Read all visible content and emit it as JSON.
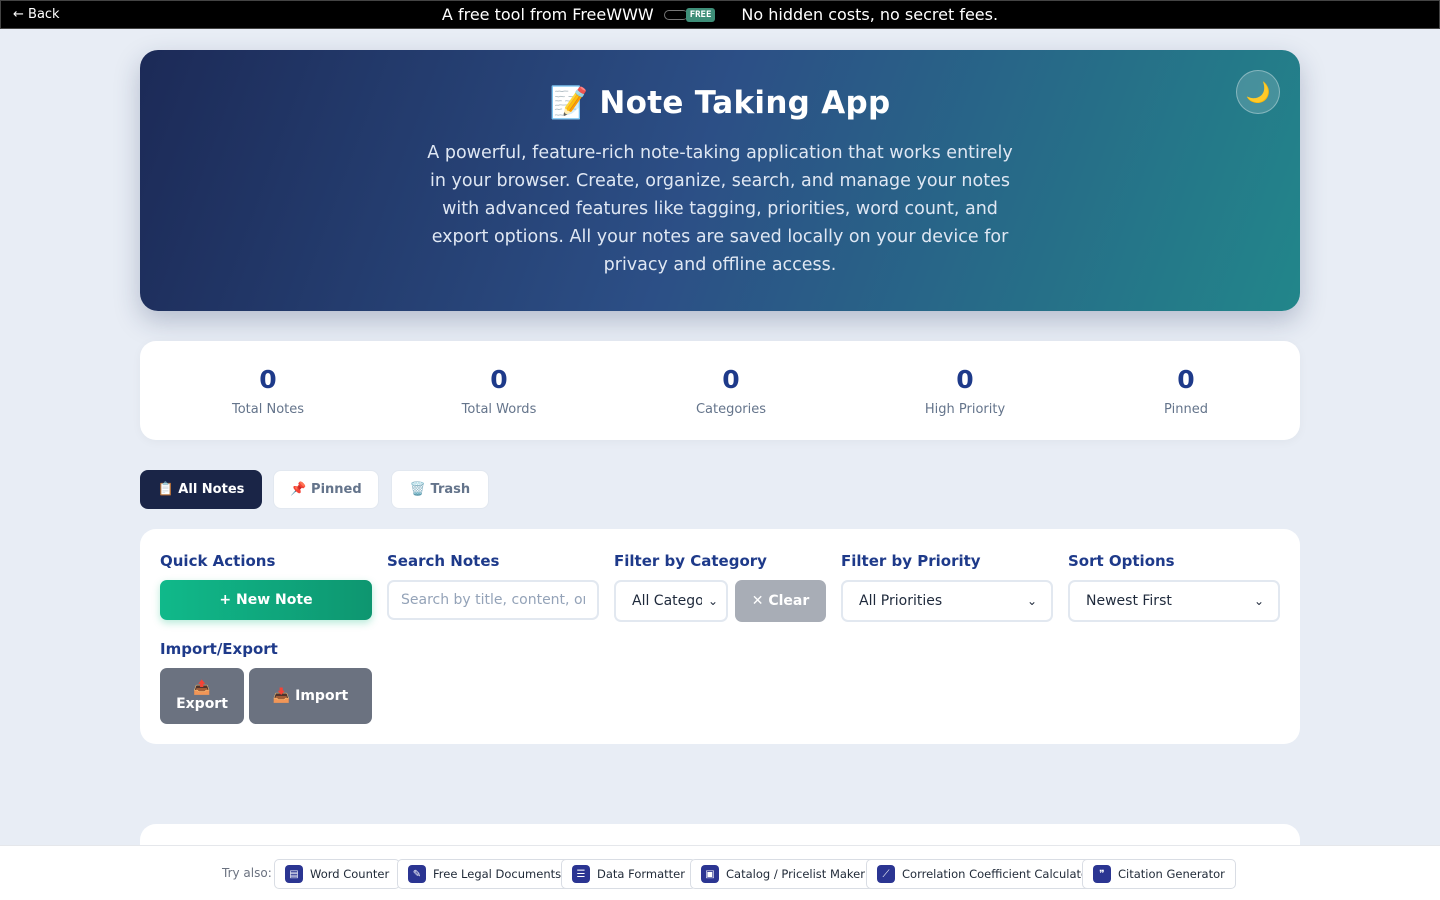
{
  "topbar": {
    "back_label": "← Back",
    "promo_text": "A free tool from FreeWWW",
    "badge_text": "FREE",
    "tagline": "No hidden costs, no secret fees."
  },
  "hero": {
    "title": "📝 Note Taking App",
    "description": "A powerful, feature-rich note-taking application that works entirely in your browser. Create, organize, search, and manage your notes with advanced features like tagging, priorities, word count, and export options. All your notes are saved locally on your device for privacy and offline access.",
    "theme_icon": "🌙"
  },
  "stats": [
    {
      "value": "0",
      "label": "Total Notes"
    },
    {
      "value": "0",
      "label": "Total Words"
    },
    {
      "value": "0",
      "label": "Categories"
    },
    {
      "value": "0",
      "label": "High Priority"
    },
    {
      "value": "0",
      "label": "Pinned"
    }
  ],
  "tabs": [
    {
      "label": "📋 All Notes",
      "active": true
    },
    {
      "label": "📌 Pinned",
      "active": false
    },
    {
      "label": "🗑️ Trash",
      "active": false
    }
  ],
  "controls": {
    "quick_actions_label": "Quick Actions",
    "new_note_label": "+ New Note",
    "search_label": "Search Notes",
    "search_placeholder": "Search by title, content, or tags...",
    "category_label": "Filter by Category",
    "category_value": "All Categories",
    "clear_label": "✕ Clear",
    "priority_label": "Filter by Priority",
    "priority_value": "All Priorities",
    "sort_label": "Sort Options",
    "sort_value": "Newest First",
    "import_export_label": "Import/Export",
    "export_icon": "📤",
    "export_label": "Export",
    "import_label": "📥 Import"
  },
  "footer": {
    "try_label": "Try also:",
    "links": [
      {
        "label": "Word Counter",
        "icon": "doc-count-icon"
      },
      {
        "label": "Free Legal Documents",
        "icon": "gavel-icon"
      },
      {
        "label": "Data Formatter",
        "icon": "list-format-icon"
      },
      {
        "label": "Catalog / Pricelist Maker",
        "icon": "catalog-icon"
      },
      {
        "label": "Correlation Coefficient Calculator",
        "icon": "chart-icon"
      },
      {
        "label": "Citation Generator",
        "icon": "quote-icon"
      }
    ]
  }
}
